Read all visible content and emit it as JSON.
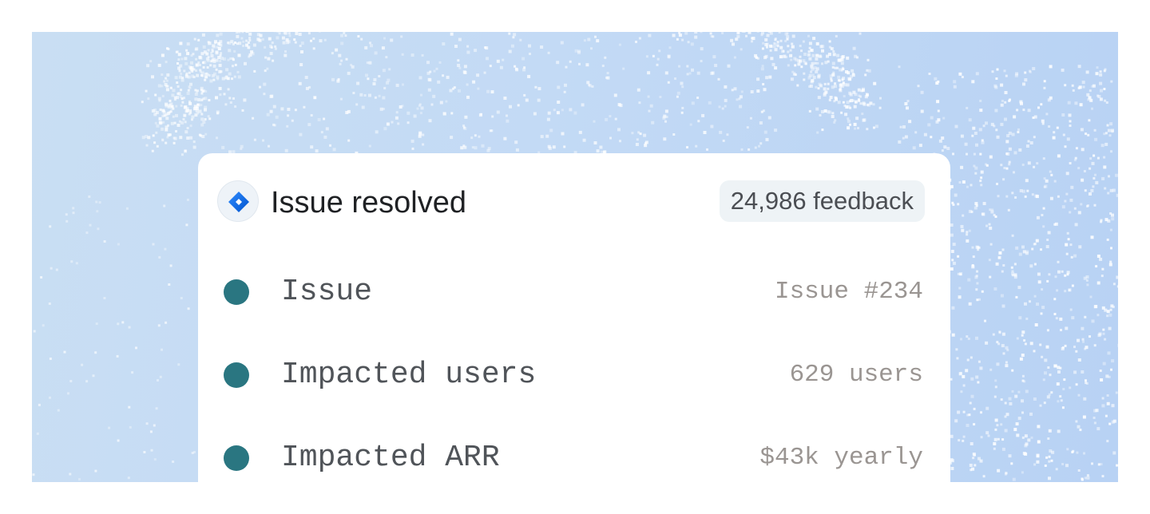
{
  "card": {
    "integration_icon": "jira-icon",
    "title": "Issue resolved",
    "feedback_count": "24,986 feedback"
  },
  "metrics": [
    {
      "label": "Issue",
      "value": "Issue #234",
      "dot_color": "#2a7681"
    },
    {
      "label": "Impacted users",
      "value": "629 users",
      "dot_color": "#2a7681"
    },
    {
      "label": "Impacted ARR",
      "value": "$43k yearly",
      "dot_color": "#2a7681"
    }
  ],
  "colors": {
    "background": "#c3daf5",
    "card": "#ffffff",
    "accent_dot": "#2a7681",
    "jira_blue": "#2684ff"
  }
}
